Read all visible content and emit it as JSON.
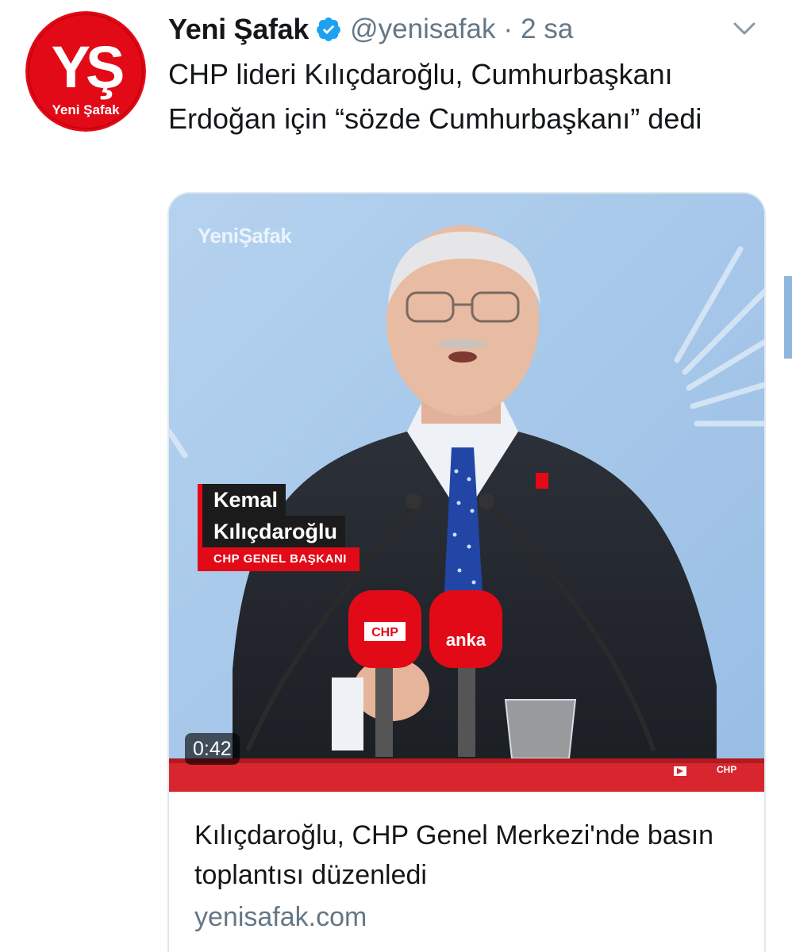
{
  "account": {
    "name": "Yeni Şafak",
    "handle": "@yenisafak",
    "separator": "·",
    "time": "2 sa",
    "avatar_logo_text": "YŞ",
    "avatar_brand_text": "Yeni Şafak"
  },
  "tweet": {
    "text": "CHP lideri Kılıçdaroğlu, Cumhurbaşkanı Erdoğan için “sözde Cumhurbaşkanı” dedi"
  },
  "card": {
    "video": {
      "watermark": "YeniŞafak",
      "lower_third_name_line1": "Kemal",
      "lower_third_name_line2": "Kılıçdaroğlu",
      "lower_third_title": "CHP GENEL BAŞKANI",
      "mic1_label": "CHP",
      "mic2_label": "anka",
      "podium_label": "CHP",
      "duration": "0:42"
    },
    "title": "Kılıçdaroğlu, CHP Genel Merkezi'nde basın toplantısı düzenledi",
    "domain": "yenisafak.com"
  },
  "colors": {
    "verified": "#1da1f2",
    "brand_red": "#e30a17",
    "secondary_text": "#657786",
    "card_border": "#e1e8ed",
    "video_background": "#a8c8ea"
  },
  "icons": [
    "verified-badge-icon",
    "chevron-down-icon",
    "video-play-icon"
  ]
}
